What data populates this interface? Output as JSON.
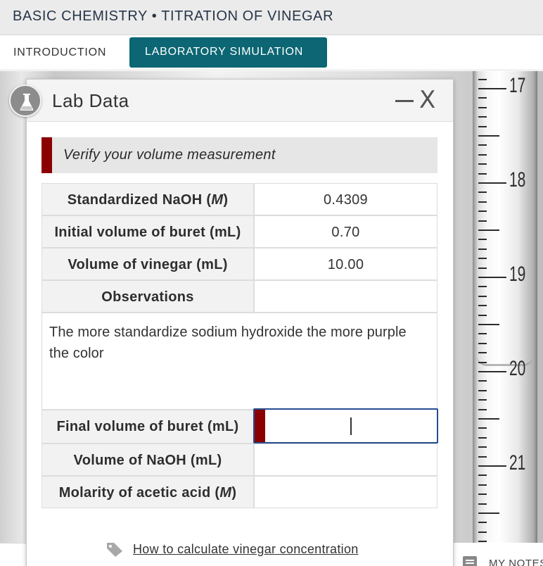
{
  "app": {
    "title": "BASIC CHEMISTRY • TITRATION OF VINEGAR"
  },
  "tabs": [
    {
      "label": "INTRODUCTION"
    },
    {
      "label": "LABORATORY SIMULATION"
    }
  ],
  "panel": {
    "title": "Lab Data",
    "close_label": "X",
    "verify_message": "Verify your volume measurement",
    "rows_top": [
      {
        "label": "Standardized NaOH (M)",
        "value": "0.4309"
      },
      {
        "label": "Initial volume of buret (mL)",
        "value": "0.70"
      },
      {
        "label": "Volume of vinegar (mL)",
        "value": "10.00"
      },
      {
        "label": "Observations",
        "value": ""
      }
    ],
    "observation_text": "The more standardize sodium hydroxide the more purple the color",
    "final_volume_label": "Final volume of buret (mL)",
    "final_volume_value": "",
    "rows_bottom": [
      {
        "label": "Volume of NaOH (mL)",
        "value": ""
      },
      {
        "label": "Molarity of acetic acid (M)",
        "value": ""
      }
    ],
    "help_link": "How to calculate vinegar concentration"
  },
  "buret": {
    "labels": [
      "17",
      "18",
      "19",
      "20",
      "21"
    ]
  },
  "notes": {
    "label": "MY NOTES"
  },
  "colors": {
    "accent": "#0c6673",
    "error": "#8b0000",
    "focus": "#254d8f"
  },
  "icons": [
    "flask-icon",
    "minimize-icon",
    "close-icon",
    "tag-icon",
    "notes-icon"
  ]
}
